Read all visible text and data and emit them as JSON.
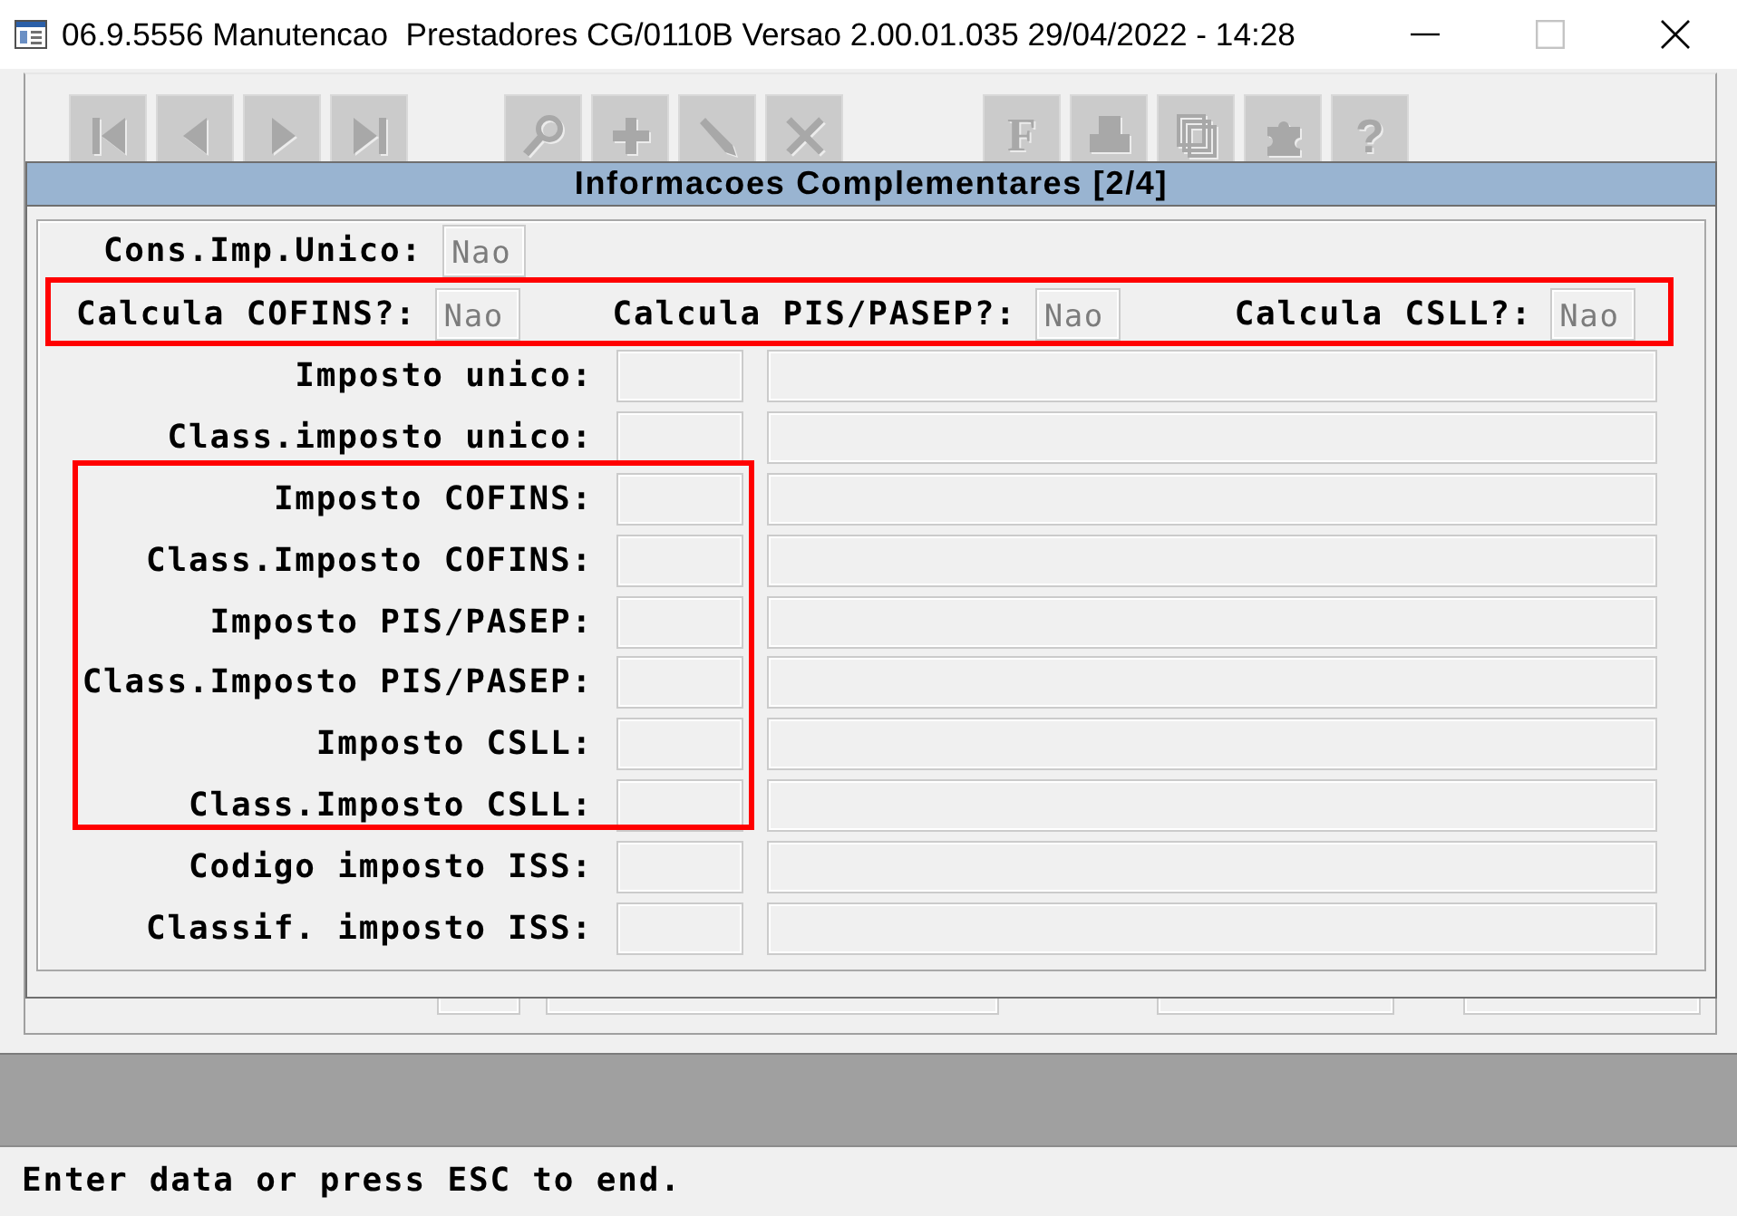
{
  "window": {
    "title": "06.9.5556 Manutencao  Prestadores CG/0110B Versao 2.00.01.035 29/04/2022 - 14:28",
    "controls": [
      {
        "kind": "minimize",
        "disabled": false
      },
      {
        "kind": "maximize",
        "disabled": true
      },
      {
        "kind": "close",
        "disabled": false
      }
    ]
  },
  "toolbar": [
    {
      "buttons": [
        {
          "kind": "first",
          "disabled": true
        },
        {
          "kind": "previous",
          "disabled": true
        },
        {
          "kind": "next",
          "disabled": true
        },
        {
          "kind": "last",
          "disabled": true
        }
      ]
    },
    {
      "buttons": [
        {
          "kind": "search",
          "disabled": true
        },
        {
          "kind": "add",
          "disabled": true
        },
        {
          "kind": "edit",
          "disabled": true
        },
        {
          "kind": "delete",
          "disabled": true
        }
      ]
    },
    {
      "buttons": [
        {
          "kind": "letter",
          "label": "F",
          "disabled": true
        },
        {
          "kind": "print",
          "disabled": true
        },
        {
          "kind": "copy",
          "disabled": true
        },
        {
          "kind": "puzzle",
          "disabled": true
        },
        {
          "kind": "symbol",
          "label": "?",
          "disabled": true
        }
      ]
    }
  ],
  "dialog": {
    "title": "Informacoes Complementares [2/4]",
    "cons_row": {
      "label": "Cons.Imp.Unico:",
      "value": "Nao",
      "disabled": true
    },
    "calc_row": {
      "highlighted": true,
      "items": [
        {
          "label": "Calcula COFINS?:",
          "value": "Nao",
          "disabled": true
        },
        {
          "label": "Calcula PIS/PASEP?:",
          "value": "Nao",
          "disabled": true
        },
        {
          "label": "Calcula CSLL?:",
          "value": "Nao",
          "disabled": true
        }
      ]
    },
    "field_groups": [
      {
        "highlighted": false,
        "rows": [
          {
            "label": "Imposto unico:"
          },
          {
            "label": "Class.imposto unico:"
          }
        ]
      },
      {
        "highlighted": true,
        "rows": [
          {
            "label": "Imposto COFINS:"
          },
          {
            "label": "Class.Imposto COFINS:"
          },
          {
            "label": "Imposto PIS/PASEP:"
          },
          {
            "label": "Class.Imposto PIS/PASEP:"
          },
          {
            "label": "Imposto CSLL:"
          },
          {
            "label": "Class.Imposto CSLL:"
          }
        ]
      },
      {
        "highlighted": false,
        "rows": [
          {
            "label": "Codigo imposto ISS:"
          },
          {
            "label": "Classif. imposto ISS:"
          }
        ]
      }
    ]
  },
  "status_bar": {
    "message": "Enter data or press ESC to end."
  }
}
